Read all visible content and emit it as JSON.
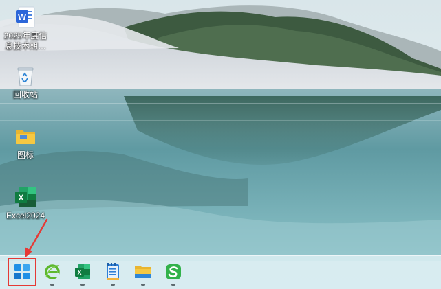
{
  "desktop": {
    "icons": [
      {
        "label": "2025年度信\n息技术期…",
        "icon": "word-document-icon"
      },
      {
        "label": "回收站",
        "icon": "recycle-bin-icon"
      },
      {
        "label": "图标",
        "icon": "folder-icon"
      },
      {
        "label": "Excel2024",
        "icon": "excel-icon"
      }
    ]
  },
  "taskbar": {
    "items": [
      {
        "name": "start",
        "icon": "windows-start-icon",
        "highlighted": true
      },
      {
        "name": "internet-explorer",
        "icon": "ie-browser-icon"
      },
      {
        "name": "excel",
        "icon": "excel-icon"
      },
      {
        "name": "notepad",
        "icon": "notepad-icon"
      },
      {
        "name": "file-explorer",
        "icon": "file-explorer-icon"
      },
      {
        "name": "wps",
        "icon": "wps-icon"
      }
    ]
  },
  "annotation": {
    "color": "#e53935",
    "target": "start"
  },
  "colors": {
    "taskbar_bg": "#d6ecf0",
    "word_blue": "#2b66d9",
    "excel_green": "#1f7a45",
    "windows_blue": "#1e90e6",
    "ie_green": "#5cb82e",
    "folder_yellow": "#f5c842",
    "wps_green": "#32b24a"
  }
}
